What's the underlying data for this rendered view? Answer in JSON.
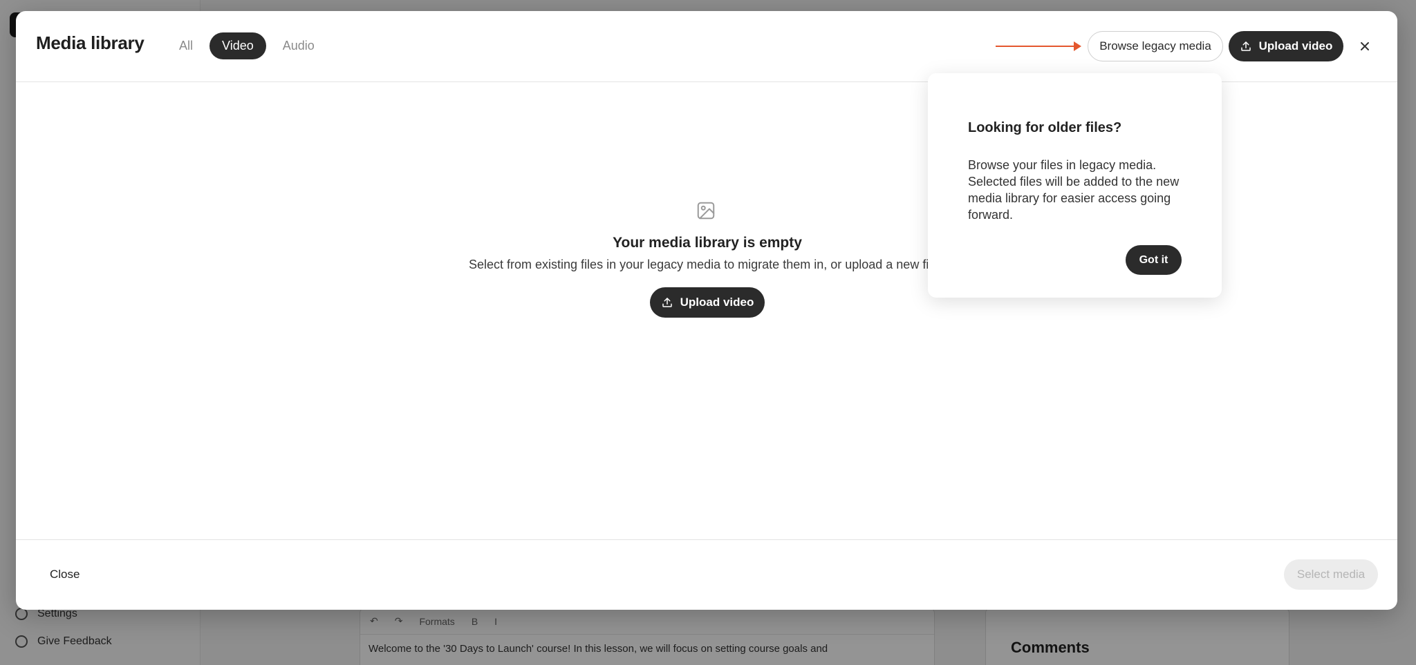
{
  "background_app": {
    "nav_items": [
      "Settings",
      "Give Feedback"
    ],
    "toolbar": [
      "Formats"
    ],
    "editor_text": "Welcome to the '30 Days to Launch' course! In this lesson, we will focus on setting course goals and",
    "comments_title": "Comments"
  },
  "modal": {
    "title": "Media library",
    "tabs": [
      {
        "label": "All",
        "active": false
      },
      {
        "label": "Video",
        "active": true
      },
      {
        "label": "Audio",
        "active": false
      }
    ],
    "browse_legacy_label": "Browse legacy media",
    "upload_label": "Upload video",
    "close_icon": "close-icon",
    "empty_state": {
      "icon": "image-placeholder-icon",
      "title": "Your media library is empty",
      "subtitle": "Select from existing files in your legacy media to migrate them in, or upload a new file.",
      "upload_label": "Upload video"
    },
    "popover": {
      "title": "Looking for older files?",
      "body": "Browse your files in legacy media. Selected files will be added to the new media library for easier access going forward.",
      "button_label": "Got it"
    },
    "footer": {
      "close_label": "Close",
      "select_label": "Select media",
      "select_enabled": false
    }
  },
  "colors": {
    "accent_arrow": "#e4572e",
    "dark_button": "#2b2b2b",
    "disabled_bg": "#ececec"
  }
}
